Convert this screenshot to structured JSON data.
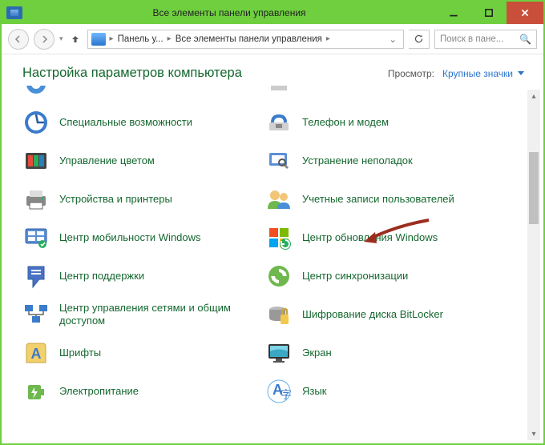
{
  "titlebar": {
    "title": "Все элементы панели управления"
  },
  "nav": {
    "breadcrumb1": "Панель у...",
    "breadcrumb2": "Все элементы панели управления",
    "search_placeholder": "Поиск в пане..."
  },
  "header": {
    "heading": "Настройка параметров компьютера",
    "view_label": "Просмотр:",
    "view_value": "Крупные значки"
  },
  "items_left": [
    {
      "label": "Специальные возможности",
      "icon": "accessibility-icon"
    },
    {
      "label": "Управление цветом",
      "icon": "color-management-icon"
    },
    {
      "label": "Устройства и принтеры",
      "icon": "devices-printers-icon"
    },
    {
      "label": "Центр мобильности Windows",
      "icon": "mobility-center-icon"
    },
    {
      "label": "Центр поддержки",
      "icon": "action-center-icon"
    },
    {
      "label": "Центр управления сетями и общим доступом",
      "icon": "network-sharing-icon"
    },
    {
      "label": "Шрифты",
      "icon": "fonts-icon"
    },
    {
      "label": "Электропитание",
      "icon": "power-options-icon"
    }
  ],
  "items_right": [
    {
      "label": "Телефон и модем",
      "icon": "phone-modem-icon"
    },
    {
      "label": "Устранение неполадок",
      "icon": "troubleshooting-icon"
    },
    {
      "label": "Учетные записи пользователей",
      "icon": "user-accounts-icon"
    },
    {
      "label": "Центр обновления Windows",
      "icon": "windows-update-icon"
    },
    {
      "label": "Центр синхронизации",
      "icon": "sync-center-icon"
    },
    {
      "label": "Шифрование диска BitLocker",
      "icon": "bitlocker-icon"
    },
    {
      "label": "Экран",
      "icon": "display-icon"
    },
    {
      "label": "Язык",
      "icon": "language-icon"
    }
  ]
}
